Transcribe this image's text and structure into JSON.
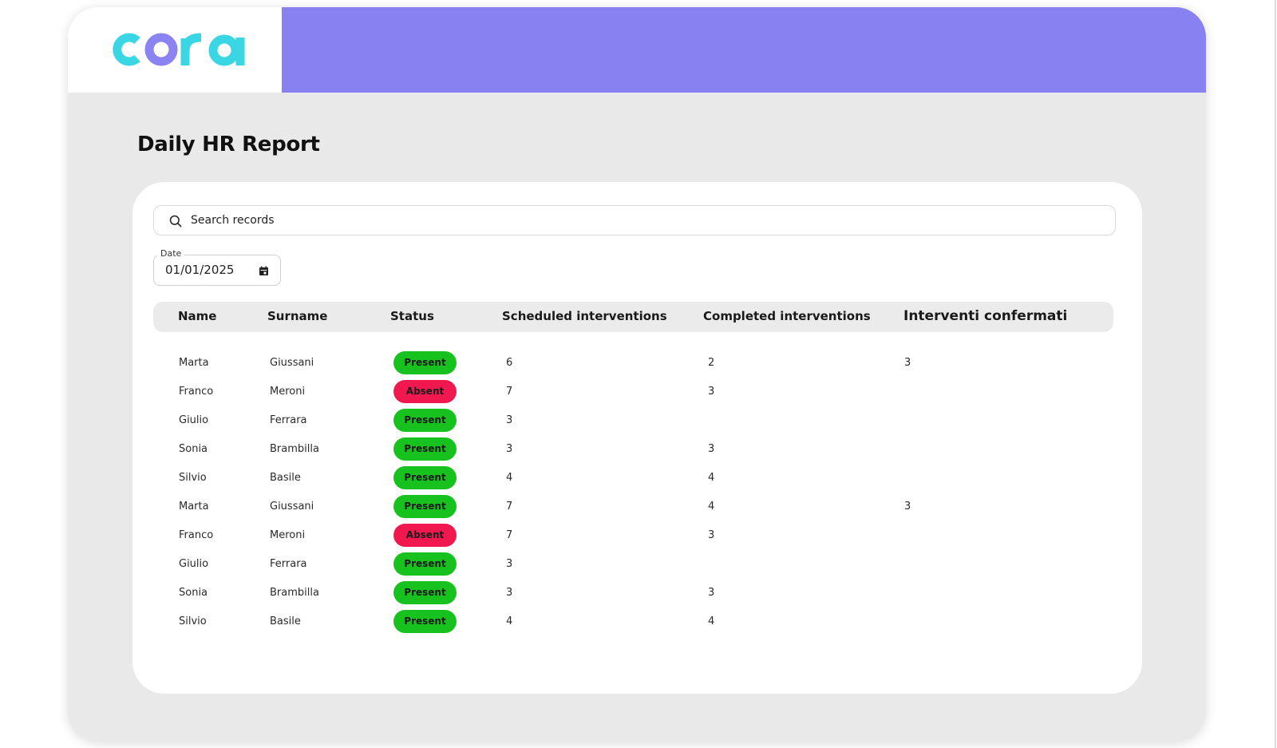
{
  "app": {
    "logo_text": "cora"
  },
  "colors": {
    "header_band": "#8781f2",
    "logo_cyan": "#3bd6e4",
    "logo_purple": "#8b83f2",
    "present": "#17c21e",
    "absent": "#f0184f"
  },
  "page": {
    "title": "Daily HR Report"
  },
  "search": {
    "placeholder": "Search records",
    "icon": "search-icon"
  },
  "date_filter": {
    "label": "Date",
    "value": "01/01/2025",
    "icon": "calendar-icon"
  },
  "table": {
    "columns": [
      "Name",
      "Surname",
      "Status",
      "Scheduled interventions",
      "Completed interventions",
      "Interventi confermati"
    ],
    "rows": [
      {
        "name": "Marta",
        "surname": "Giussani",
        "status": "Present",
        "scheduled": "6",
        "completed": "2",
        "confirmed": "3"
      },
      {
        "name": "Franco",
        "surname": "Meroni",
        "status": "Absent",
        "scheduled": "7",
        "completed": "3",
        "confirmed": ""
      },
      {
        "name": "Giulio",
        "surname": "Ferrara",
        "status": "Present",
        "scheduled": "3",
        "completed": "",
        "confirmed": ""
      },
      {
        "name": "Sonia",
        "surname": "Brambilla",
        "status": "Present",
        "scheduled": "3",
        "completed": "3",
        "confirmed": ""
      },
      {
        "name": "Silvio",
        "surname": "Basile",
        "status": "Present",
        "scheduled": "4",
        "completed": "4",
        "confirmed": ""
      },
      {
        "name": "Marta",
        "surname": "Giussani",
        "status": "Present",
        "scheduled": "7",
        "completed": "4",
        "confirmed": "3"
      },
      {
        "name": "Franco",
        "surname": "Meroni",
        "status": "Absent",
        "scheduled": "7",
        "completed": "3",
        "confirmed": ""
      },
      {
        "name": "Giulio",
        "surname": "Ferrara",
        "status": "Present",
        "scheduled": "3",
        "completed": "",
        "confirmed": ""
      },
      {
        "name": "Sonia",
        "surname": "Brambilla",
        "status": "Present",
        "scheduled": "3",
        "completed": "3",
        "confirmed": ""
      },
      {
        "name": "Silvio",
        "surname": "Basile",
        "status": "Present",
        "scheduled": "4",
        "completed": "4",
        "confirmed": ""
      }
    ]
  }
}
